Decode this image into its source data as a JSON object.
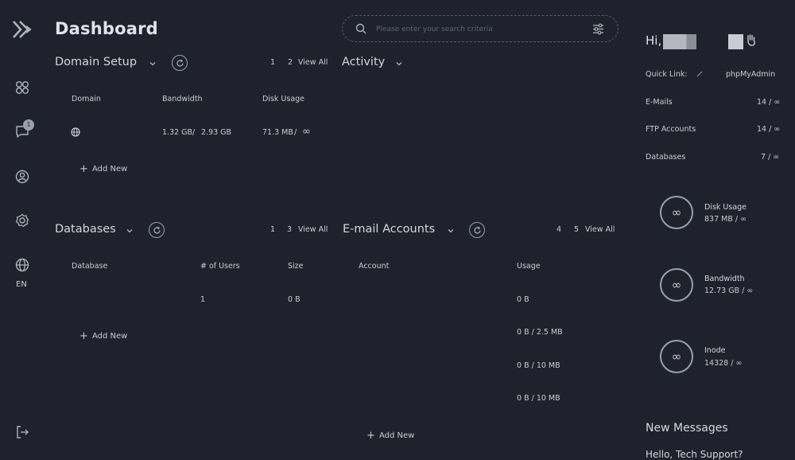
{
  "header": {
    "title": "Dashboard",
    "search_placeholder": "Please enter your search criteria"
  },
  "rail": {
    "language": "EN",
    "notifications_count": "1",
    "icons": [
      "grid-icon",
      "chat-icon",
      "user-icon",
      "settings-icon",
      "globe-icon",
      "logout-icon"
    ]
  },
  "domain_setup": {
    "title": "Domain Setup",
    "pages": [
      "1",
      "2"
    ],
    "view_all": "View All",
    "columns": [
      "Domain",
      "Bandwidth",
      "Disk Usage"
    ],
    "rows": [
      {
        "bandwidth_used": "1.32 GB",
        "sep": "/",
        "bandwidth_total": "2.93 GB",
        "disk_used": "71.3 MB",
        "disk_sep": "/",
        "disk_total": "∞"
      }
    ],
    "add_new": "Add New"
  },
  "activity": {
    "title": "Activity"
  },
  "databases": {
    "title": "Databases",
    "pages": [
      "1",
      "3"
    ],
    "view_all": "View All",
    "columns": [
      "Database",
      "# of Users",
      "Size"
    ],
    "rows": [
      {
        "database": "",
        "users": "1",
        "size": "0 B"
      }
    ],
    "add_new": "Add New"
  },
  "email_accounts": {
    "title": "E-mail Accounts",
    "pages": [
      "4",
      "5"
    ],
    "view_all": "View All",
    "columns": [
      "Account",
      "Usage"
    ],
    "rows": [
      {
        "usage": "0 B"
      },
      {
        "usage": "0 B / 2.5 MB"
      },
      {
        "usage": "0 B / 10 MB"
      },
      {
        "usage": "0 B / 10 MB"
      }
    ],
    "add_new": "Add New"
  },
  "sidebar": {
    "greeting": "Hi,",
    "quick_link_label": "Quick Link:",
    "quick_link_value": "phpMyAdmin",
    "stats": [
      {
        "label": "E-Mails",
        "value": "14 / ∞"
      },
      {
        "label": "FTP Accounts",
        "value": "14 / ∞"
      },
      {
        "label": "Databases",
        "value": "7 / ∞"
      }
    ],
    "gauges": [
      {
        "label": "Disk Usage",
        "value": "837 MB  /  ∞",
        "symbol": "∞"
      },
      {
        "label": "Bandwidth",
        "value": "12.73 GB  /  ∞",
        "symbol": "∞"
      },
      {
        "label": "Inode",
        "value": "14328  /  ∞",
        "symbol": "∞"
      }
    ],
    "new_messages": "New Messages",
    "message_preview": "Hello, Tech Support?"
  }
}
